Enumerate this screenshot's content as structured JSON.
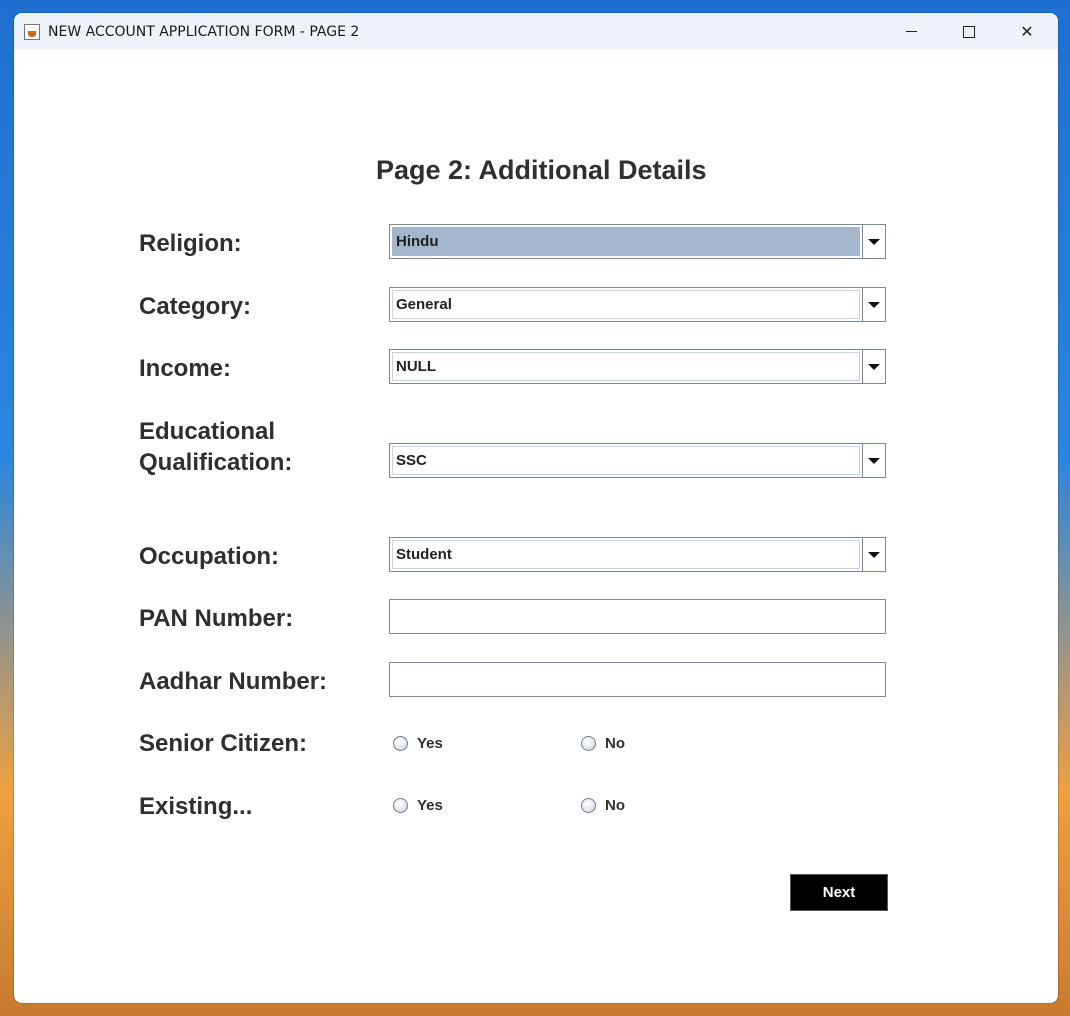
{
  "window": {
    "title": "NEW ACCOUNT APPLICATION FORM - PAGE 2"
  },
  "heading": "Page 2: Additional Details",
  "fields": {
    "religion": {
      "label": "Religion:",
      "value": "Hindu"
    },
    "category": {
      "label": "Category:",
      "value": "General"
    },
    "income": {
      "label": "Income:",
      "value": "NULL"
    },
    "education": {
      "label_line1": "Educational",
      "label_line2": "Qualification:",
      "value": "SSC"
    },
    "occupation": {
      "label": "Occupation:",
      "value": "Student"
    },
    "pan": {
      "label": "PAN Number:",
      "value": ""
    },
    "aadhar": {
      "label": "Aadhar Number:",
      "value": ""
    },
    "senior_citizen": {
      "label": "Senior Citizen:",
      "yes": "Yes",
      "no": "No"
    },
    "existing": {
      "label": "Existing...",
      "yes": "Yes",
      "no": "No"
    }
  },
  "next_label": "Next"
}
